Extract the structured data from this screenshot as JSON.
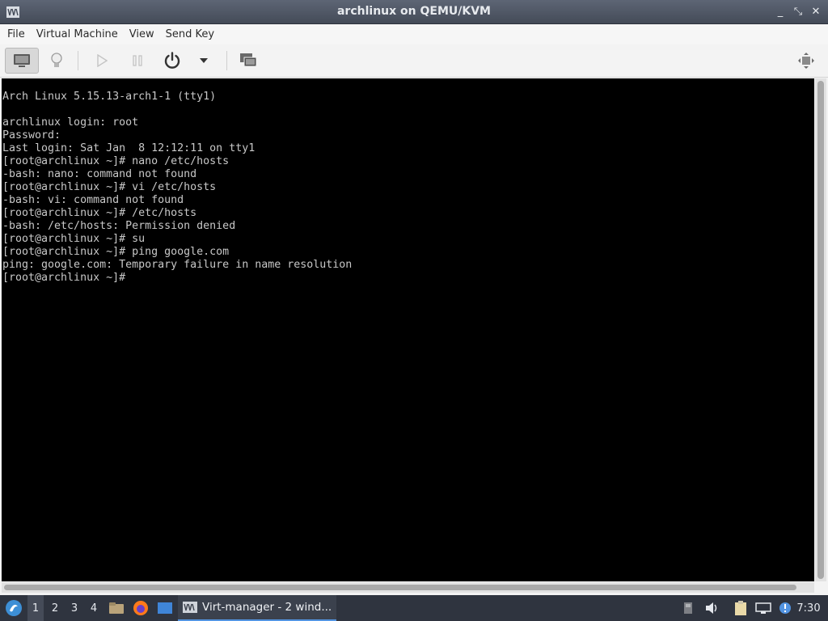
{
  "window": {
    "title": "archlinux on QEMU/KVM",
    "controls": {
      "minimize": "_",
      "restore": "⤡",
      "close": "✕"
    }
  },
  "menu": [
    "File",
    "Virtual Machine",
    "View",
    "Send Key"
  ],
  "toolbar": {
    "icons": [
      "monitor-icon",
      "lightbulb-icon",
      "play-icon",
      "pause-icon",
      "power-icon",
      "dropdown-arrow-icon",
      "screens-icon",
      "fullscreen-icon"
    ]
  },
  "console": {
    "lines": [
      "Arch Linux 5.15.13-arch1-1 (tty1)",
      "",
      "archlinux login: root",
      "Password:",
      "Last login: Sat Jan  8 12:12:11 on tty1",
      "[root@archlinux ~]# nano /etc/hosts",
      "-bash: nano: command not found",
      "[root@archlinux ~]# vi /etc/hosts",
      "-bash: vi: command not found",
      "[root@archlinux ~]# /etc/hosts",
      "-bash: /etc/hosts: Permission denied",
      "[root@archlinux ~]# su",
      "[root@archlinux ~]# ping google.com",
      "ping: google.com: Temporary failure in name resolution",
      "[root@archlinux ~]#"
    ]
  },
  "taskbar": {
    "workspaces": [
      "1",
      "2",
      "3",
      "4"
    ],
    "task_label": "Virt-manager - 2 wind...",
    "clock": "7:30",
    "colors": {
      "accent": "#5294e2",
      "panel": "#2f343f"
    }
  }
}
